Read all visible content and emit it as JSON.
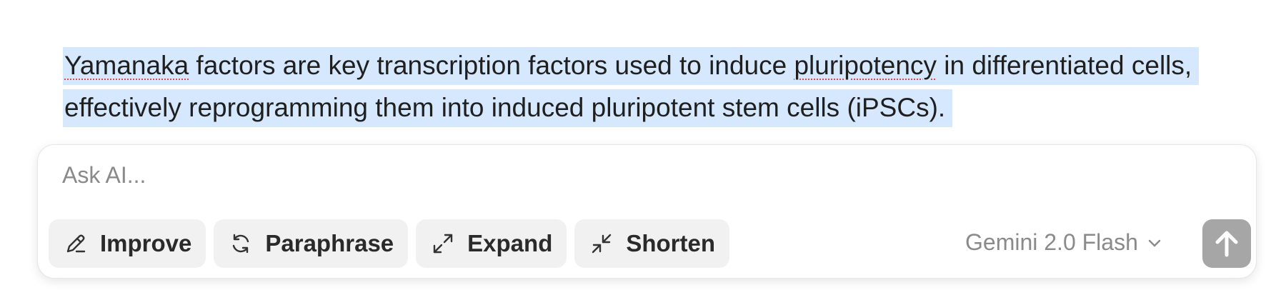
{
  "editor": {
    "selected_paragraph": {
      "w1": "Yamanaka",
      "t2": " factors are key transcription factors used to induce ",
      "w2": "pluripotency",
      "t3": " in differentiated cells, effectively reprogramming them into induced pluripotent stem cells (iPSCs)."
    }
  },
  "ai_panel": {
    "placeholder": "Ask AI...",
    "actions": [
      {
        "label": "Improve",
        "icon": "pencil-icon"
      },
      {
        "label": "Paraphrase",
        "icon": "refresh-icon"
      },
      {
        "label": "Expand",
        "icon": "expand-arrows-icon"
      },
      {
        "label": "Shorten",
        "icon": "collapse-arrows-icon"
      }
    ],
    "model": "Gemini 2.0 Flash",
    "send_icon": "arrow-up-icon"
  },
  "colors": {
    "selection": "#d6e8fd",
    "chip_bg": "#f1f1f1",
    "send_bg": "#a6a6a6",
    "spellcheck": "#e0484f"
  }
}
